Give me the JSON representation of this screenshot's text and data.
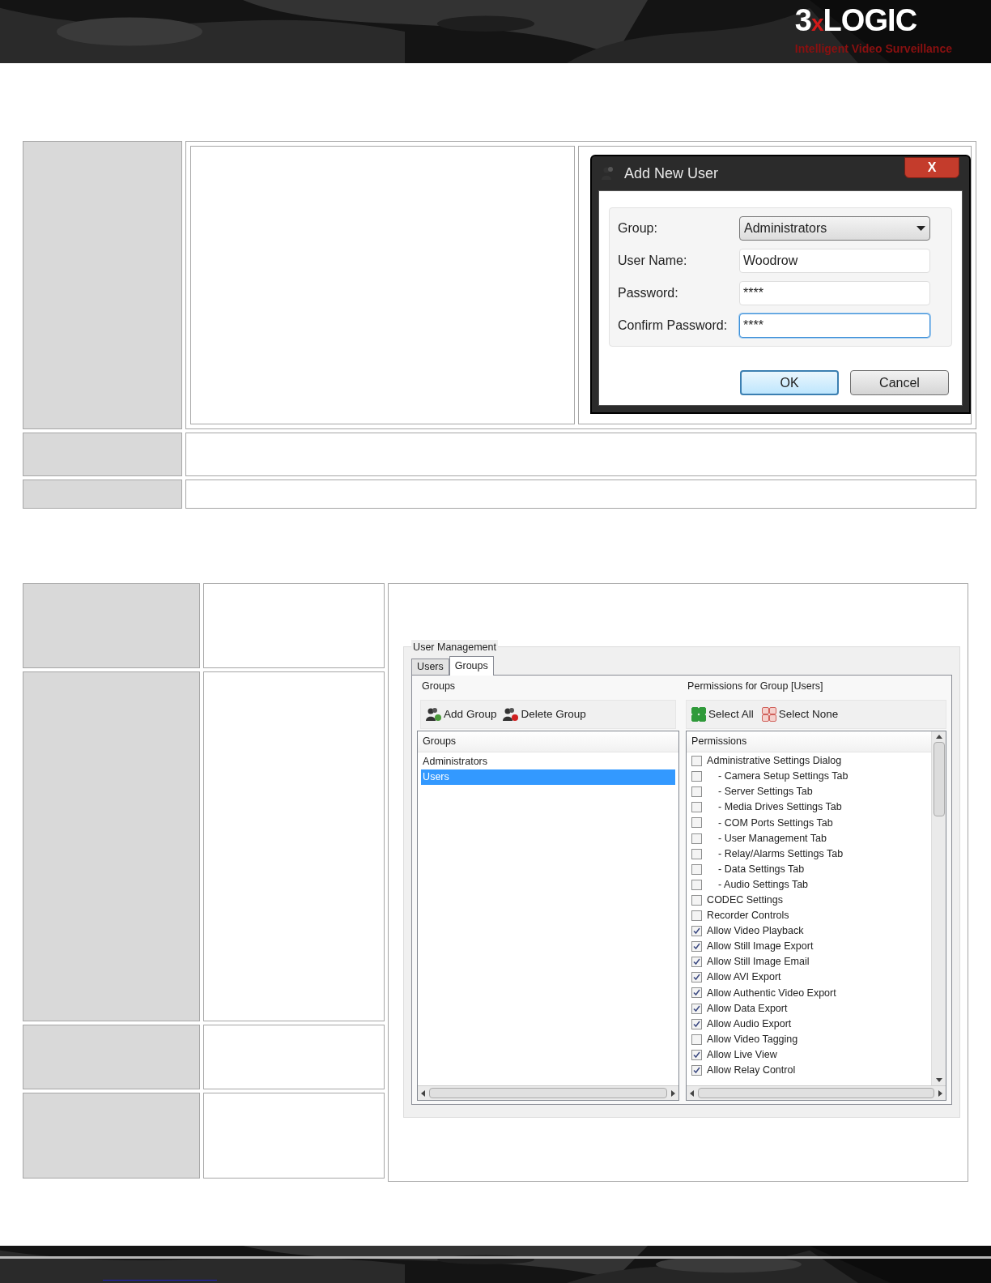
{
  "header": {
    "logo": {
      "lead": "3",
      "mark": "x",
      "name": "LOGIC"
    },
    "tagline": "Intelligent Video Surveillance"
  },
  "dialog": {
    "title": "Add New User",
    "close": "X",
    "fields": [
      {
        "kind": "select",
        "label": "Group:",
        "value": "Administrators",
        "focused": false
      },
      {
        "kind": "text",
        "label": "User Name:",
        "value": "Woodrow",
        "focused": false
      },
      {
        "kind": "text",
        "label": "Password:",
        "value": "****",
        "focused": false
      },
      {
        "kind": "text",
        "label": "Confirm Password:",
        "value": "****",
        "focused": true
      }
    ],
    "buttons": [
      {
        "label": "OK",
        "default": true
      },
      {
        "label": "Cancel",
        "default": false
      }
    ]
  },
  "user_management": {
    "title": "User Management",
    "tabs": [
      {
        "label": "Users",
        "selected": false
      },
      {
        "label": "Groups",
        "selected": true
      }
    ],
    "groups_panel": {
      "title": "Groups",
      "toolbar": [
        {
          "kind": "add",
          "label": "Add Group"
        },
        {
          "kind": "delete",
          "label": "Delete Group"
        }
      ],
      "list_header": "Groups",
      "items": [
        {
          "label": "Administrators",
          "selected": false
        },
        {
          "label": "Users",
          "selected": true
        }
      ]
    },
    "permissions_panel": {
      "title": "Permissions for Group [Users]",
      "toolbar": [
        {
          "kind": "all",
          "label": "Select All"
        },
        {
          "kind": "none",
          "label": "Select None"
        }
      ],
      "list_header": "Permissions",
      "items": [
        {
          "label": "Administrative Settings Dialog",
          "checked": false,
          "children": [
            {
              "label": "- Camera Setup Settings Tab",
              "checked": false
            },
            {
              "label": "- Server Settings Tab",
              "checked": false
            },
            {
              "label": "- Media Drives Settings Tab",
              "checked": false
            },
            {
              "label": "- COM Ports Settings Tab",
              "checked": false
            },
            {
              "label": "- User Management Tab",
              "checked": false
            },
            {
              "label": "- Relay/Alarms Settings Tab",
              "checked": false
            },
            {
              "label": "- Data Settings Tab",
              "checked": false
            },
            {
              "label": "- Audio Settings Tab",
              "checked": false
            }
          ]
        },
        {
          "label": "CODEC Settings",
          "checked": false
        },
        {
          "label": "Recorder Controls",
          "checked": false
        },
        {
          "label": "Allow Video Playback",
          "checked": true
        },
        {
          "label": "Allow Still Image Export",
          "checked": true
        },
        {
          "label": "Allow Still Image Email",
          "checked": true
        },
        {
          "label": "Allow AVI Export",
          "checked": true
        },
        {
          "label": "Allow Authentic Video Export",
          "checked": true
        },
        {
          "label": "Allow Data Export",
          "checked": true
        },
        {
          "label": "Allow Audio Export",
          "checked": true
        },
        {
          "label": "Allow Video Tagging",
          "checked": false
        },
        {
          "label": "Allow Live View",
          "checked": true
        },
        {
          "label": "Allow Relay Control",
          "checked": true
        }
      ]
    }
  }
}
